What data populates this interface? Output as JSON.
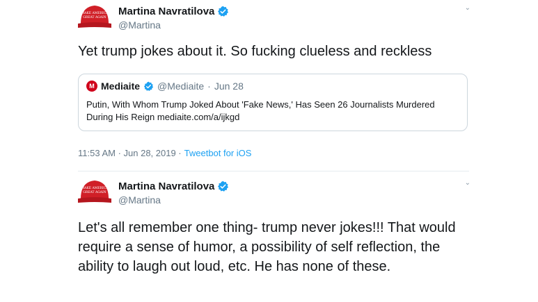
{
  "colors": {
    "verified": "#1da1f2",
    "hat": "#d01f27",
    "link": "#1da1f2",
    "muted": "#657786"
  },
  "tweets": [
    {
      "user": {
        "display_name": "Martina Navratilova",
        "handle": "@Martina",
        "verified": true,
        "avatar_icon": "red-cap-avatar",
        "avatar_text": "MAKE AMERICA GREAT AGAIN"
      },
      "text": "Yet trump jokes about it. So fucking clueless and reckless",
      "quote": {
        "logo_letter": "M",
        "name": "Mediaite",
        "handle": "@Mediaite",
        "separator": "·",
        "date": "Jun 28",
        "verified": true,
        "text": "Putin, With Whom Trump Joked About 'Fake News,' Has Seen 26 Journalists Murdered During His Reign mediaite.com/a/ijkgd"
      },
      "meta": {
        "time": "11:53 AM · Jun 28, 2019 ·",
        "source": "Tweetbot for iOS"
      }
    },
    {
      "user": {
        "display_name": "Martina Navratilova",
        "handle": "@Martina",
        "verified": true,
        "avatar_icon": "red-cap-avatar",
        "avatar_text": "MAKE AMERICA GREAT AGAIN"
      },
      "text": "Let's all remember one thing- trump never jokes!!! That would require a sense of humor, a possibility of self reflection, the ability to laugh out loud, etc. He has none of these."
    }
  ]
}
